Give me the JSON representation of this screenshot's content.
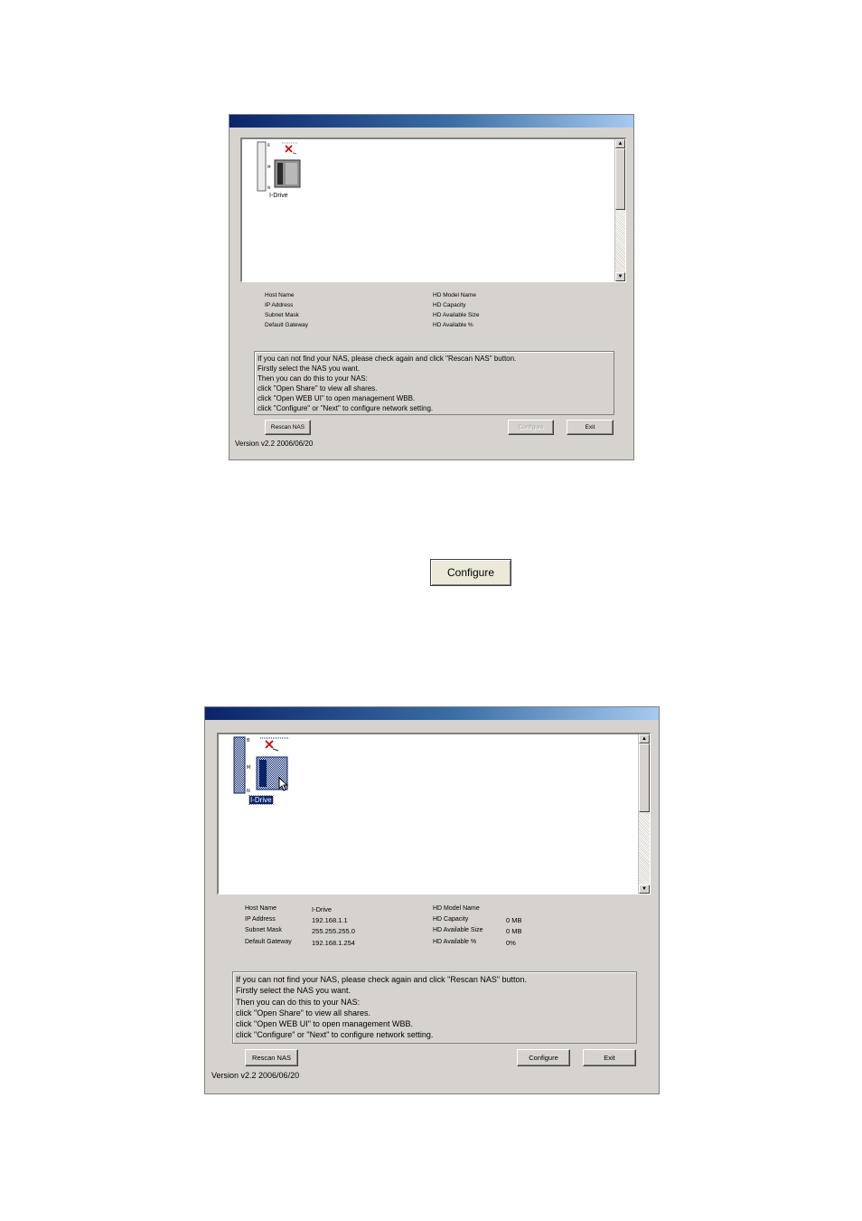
{
  "device": {
    "name": "I-Drive"
  },
  "info_labels": {
    "host_name": "Host Name",
    "ip_address": "IP Address",
    "subnet_mask": "Subnet Mask",
    "default_gateway": "Default Gateway",
    "hd_model_name": "HD Model Name",
    "hd_capacity": "HD Capacity",
    "hd_available_size": "HD Available Size",
    "hd_available_pct": "HD Available %"
  },
  "info_values": {
    "host_name": "I-Drive",
    "ip_address": "192.168.1.1",
    "subnet_mask": "255.255.255.0",
    "default_gateway": "192.168.1.254",
    "hd_capacity": "0 MB",
    "hd_available_size": "0 MB",
    "hd_available_pct": "0%"
  },
  "instructions": [
    "If you can not find your NAS, please check again and click \"Rescan NAS\" button.",
    "Firstly select the NAS you want.",
    "Then you can do this to your NAS:",
    " click \"Open Share\" to view all shares.",
    " click \"Open WEB UI\" to open management WBB.",
    " click \"Configure\" or \"Next\" to configure network setting."
  ],
  "buttons": {
    "rescan": "Rescan NAS",
    "configure": "Configure",
    "exit": "Exit"
  },
  "version": "Version v2.2 2006/06/20",
  "standalone_button": {
    "label": "Configure"
  },
  "scroll_arrows": {
    "up": "▲",
    "down": "▼"
  },
  "icons": [
    "nas-device-icon",
    "disconnected-x-icon",
    "mouse-pointer-icon"
  ]
}
